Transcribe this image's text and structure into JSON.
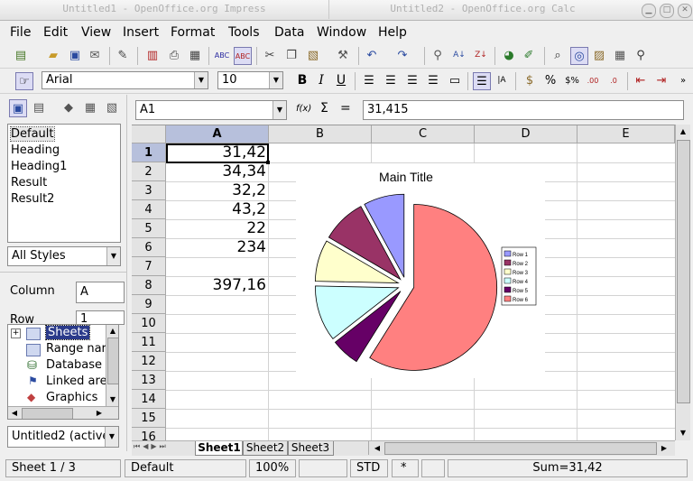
{
  "titlebar": {
    "tab1": "Untitled1 - OpenOffice.org Impress",
    "tab2": "Untitled2 - OpenOffice.org Calc"
  },
  "menus": [
    "File",
    "Edit",
    "View",
    "Insert",
    "Format",
    "Tools",
    "Data",
    "Window",
    "Help"
  ],
  "formatting": {
    "font_name": "Arial",
    "font_size": "10"
  },
  "styles_panel": {
    "styles": [
      "Default",
      "Heading",
      "Heading1",
      "Result",
      "Result2"
    ],
    "filter": "All Styles"
  },
  "navigator": {
    "column_label": "Column",
    "column_value": "A",
    "row_label": "Row",
    "row_value": "1",
    "tree": [
      "Sheets",
      "Range nar",
      "Database",
      "Linked are",
      "Graphics"
    ],
    "document": "Untitled2 (active"
  },
  "formula_bar": {
    "cell_ref": "A1",
    "fx": "f(x)",
    "sigma": "Σ",
    "equals": "=",
    "content": "31,415"
  },
  "sheet": {
    "columns": [
      "A",
      "B",
      "C",
      "D",
      "E"
    ],
    "rows": [
      "1",
      "2",
      "3",
      "4",
      "5",
      "6",
      "7",
      "8",
      "9",
      "10",
      "11",
      "12",
      "13",
      "14",
      "15",
      "16"
    ],
    "column_a": [
      "31,42",
      "34,34",
      "32,2",
      "43,2",
      "22",
      "234",
      "",
      "397,16"
    ]
  },
  "tabs": [
    "Sheet1",
    "Sheet2",
    "Sheet3"
  ],
  "status": {
    "sheet": "Sheet 1 / 3",
    "style": "Default",
    "zoom": "100%",
    "mode": "STD",
    "modified": "*",
    "sum": "Sum=31,42"
  },
  "chart_data": {
    "type": "pie",
    "title": "Main Title",
    "categories": [
      "Row 1",
      "Row 2",
      "Row 3",
      "Row 4",
      "Row 5",
      "Row 6"
    ],
    "values": [
      31.42,
      34.34,
      32.2,
      43.2,
      22,
      234
    ],
    "colors": [
      "#9999ff",
      "#993366",
      "#ffffcc",
      "#ccffff",
      "#660066",
      "#ff8080"
    ],
    "legend_position": "right",
    "exploded": true
  }
}
